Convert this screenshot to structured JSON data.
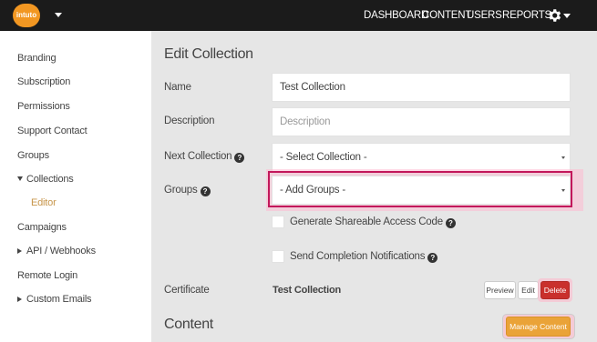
{
  "topbar": {
    "logo_text": "intuto",
    "nav": [
      "DASHBOARD",
      "CONTENT",
      "USERS",
      "REPORTS"
    ],
    "settings_icon": "gear-icon"
  },
  "sidebar": {
    "items": [
      {
        "label": "Branding"
      },
      {
        "label": "Subscription"
      },
      {
        "label": "Permissions"
      },
      {
        "label": "Support Contact"
      },
      {
        "label": "Groups"
      },
      {
        "label": "Collections",
        "expanded": true
      },
      {
        "label": "Editor",
        "active": true
      },
      {
        "label": "Campaigns"
      },
      {
        "label": "API / Webhooks",
        "collapsed": true
      },
      {
        "label": "Remote Login"
      },
      {
        "label": "Custom Emails",
        "collapsed": true
      }
    ]
  },
  "main": {
    "title": "Edit Collection",
    "fields": {
      "name": {
        "label": "Name",
        "value": "Test Collection"
      },
      "description": {
        "label": "Description",
        "placeholder": "Description"
      },
      "next_collection": {
        "label": "Next Collection",
        "value": "- Select Collection -"
      },
      "groups": {
        "label": "Groups",
        "value": "- Add Groups -"
      }
    },
    "checkboxes": [
      {
        "label": "Generate Shareable Access Code",
        "checked": false
      },
      {
        "label": "Send Completion Notifications",
        "checked": false
      }
    ],
    "certificate": {
      "label": "Certificate",
      "value": "Test Collection",
      "buttons": {
        "preview": "Preview",
        "edit": "Edit",
        "delete": "Delete"
      }
    },
    "content": {
      "title": "Content",
      "manage_button": "Manage Content"
    }
  },
  "colors": {
    "accent": "#f29722",
    "delete": "#c9302c",
    "manage": "#eaa338",
    "highlight": "#c2185b",
    "active_sidebar": "#c7954a"
  }
}
